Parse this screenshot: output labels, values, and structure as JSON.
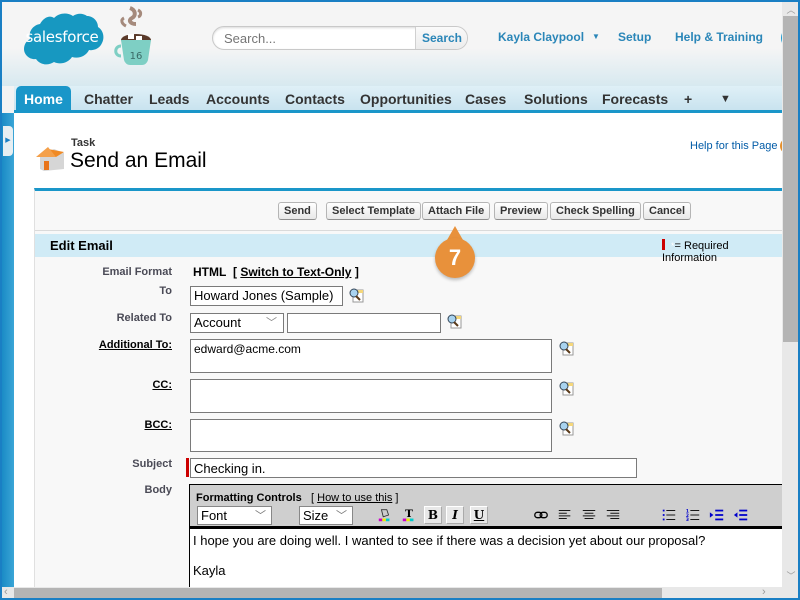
{
  "header": {
    "brand": "salesforce",
    "mug_badge": "16",
    "search": {
      "placeholder": "Search...",
      "button_label": "Search"
    },
    "user_menu": "Kayla Claypool",
    "setup": "Setup",
    "help_training": "Help & Training"
  },
  "tabs": [
    {
      "label": "Home",
      "active": true
    },
    {
      "label": "Chatter"
    },
    {
      "label": "Leads"
    },
    {
      "label": "Accounts"
    },
    {
      "label": "Contacts"
    },
    {
      "label": "Opportunities"
    },
    {
      "label": "Cases"
    },
    {
      "label": "Solutions"
    },
    {
      "label": "Forecasts"
    },
    {
      "label": "+",
      "icon": "plus-icon"
    },
    {
      "label": "▼",
      "icon": "chevron-down-icon"
    }
  ],
  "page": {
    "object_type": "Task",
    "title": "Send an Email",
    "help_link": "Help for this Page"
  },
  "buttons": {
    "send": "Send",
    "select_template": "Select Template",
    "attach_file": "Attach File",
    "preview": "Preview",
    "check_spelling": "Check Spelling",
    "cancel": "Cancel"
  },
  "section": {
    "title": "Edit Email",
    "required_legend": "= Required Information",
    "required_star": "*"
  },
  "form": {
    "email_format": {
      "label": "Email Format",
      "value": "HTML",
      "switch_prefix": "[",
      "switch_link": "Switch to Text-Only",
      "switch_suffix": "]"
    },
    "to": {
      "label": "To",
      "value": "Howard Jones (Sample)"
    },
    "related_to": {
      "label": "Related To",
      "type_value": "Account",
      "value": ""
    },
    "additional_to": {
      "label": "Additional To:",
      "value": "edward@acme.com"
    },
    "cc": {
      "label": "CC:",
      "value": ""
    },
    "bcc": {
      "label": "BCC:",
      "value": ""
    },
    "subject": {
      "label": "Subject",
      "value": "Checking in."
    },
    "body": {
      "label": "Body",
      "toolbar": {
        "title": "Formatting Controls",
        "help_prefix": "[",
        "help_link": "How to use this",
        "help_suffix": "]",
        "font": "Font",
        "size": "Size",
        "bold": "B",
        "italic": "I",
        "underline": "U"
      },
      "lines": [
        "I hope you are doing well. I wanted to see if there was a decision yet about our proposal?",
        "Kayla"
      ]
    }
  },
  "callout": {
    "step": "7"
  },
  "colors": {
    "brand_blue": "#1a96c9",
    "link_blue": "#2a86b8",
    "required_red": "#cc0000",
    "callout_orange": "#e8913b",
    "section_bg": "#d0ebf6"
  }
}
